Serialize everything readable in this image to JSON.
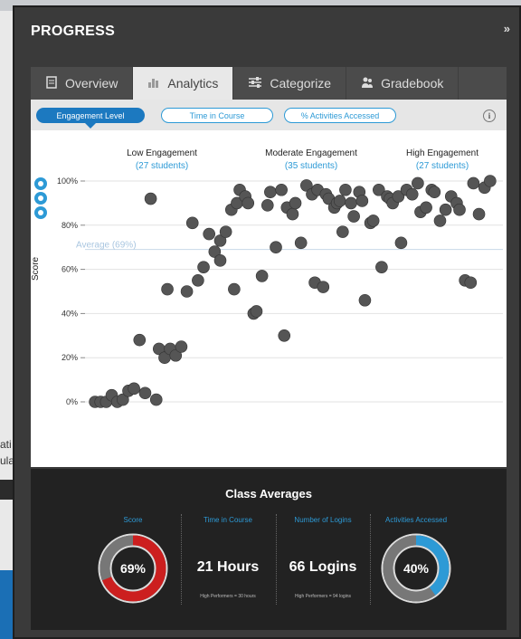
{
  "background": {
    "left_snippet": [
      "ati",
      "ula"
    ]
  },
  "panel": {
    "title": "PROGRESS",
    "collapse_icon": "double-chevron-right-icon"
  },
  "tabs": [
    {
      "label": "Overview",
      "icon": "book-icon",
      "active": false
    },
    {
      "label": "Analytics",
      "icon": "bar-chart-icon",
      "active": true
    },
    {
      "label": "Categorize",
      "icon": "sliders-icon",
      "active": false
    },
    {
      "label": "Gradebook",
      "icon": "people-icon",
      "active": false
    }
  ],
  "subtabs": [
    {
      "label": "Engagement Level",
      "active": true
    },
    {
      "label": "Time in Course",
      "active": false
    },
    {
      "label": "% Activities Accessed",
      "active": false
    }
  ],
  "groups": [
    {
      "label": "Low Engagement",
      "count": "(27 students)"
    },
    {
      "label": "Moderate Engagement",
      "count": "(35 students)"
    },
    {
      "label": "High Engagement",
      "count": "(27 students)"
    }
  ],
  "chart_data": {
    "type": "scatter",
    "ylabel": "Score",
    "ylim": [
      0,
      100
    ],
    "y_ticks": [
      "0%",
      "20%",
      "40%",
      "60%",
      "80%",
      "100%"
    ],
    "average_label": "Average (69%)",
    "average_value": 69,
    "x_range": [
      0,
      100
    ],
    "points": [
      [
        1,
        0
      ],
      [
        3,
        0
      ],
      [
        5,
        0
      ],
      [
        7,
        3
      ],
      [
        9,
        0
      ],
      [
        11,
        1
      ],
      [
        13,
        5
      ],
      [
        15,
        6
      ],
      [
        17,
        28
      ],
      [
        19,
        4
      ],
      [
        21,
        92
      ],
      [
        23,
        1
      ],
      [
        24,
        24
      ],
      [
        26,
        20
      ],
      [
        28,
        24
      ],
      [
        30,
        21
      ],
      [
        32,
        25
      ],
      [
        27,
        51
      ],
      [
        34,
        50
      ],
      [
        36,
        81
      ],
      [
        38,
        55
      ],
      [
        40,
        61
      ],
      [
        42,
        76
      ],
      [
        44,
        68
      ],
      [
        46,
        73
      ],
      [
        48,
        77
      ],
      [
        46,
        64
      ],
      [
        50,
        87
      ],
      [
        51,
        51
      ],
      [
        52,
        90
      ],
      [
        53,
        96
      ],
      [
        55,
        93
      ],
      [
        56,
        90
      ],
      [
        58,
        40
      ],
      [
        59,
        41
      ],
      [
        61,
        57
      ],
      [
        63,
        89
      ],
      [
        64,
        95
      ],
      [
        66,
        70
      ],
      [
        68,
        96
      ],
      [
        69,
        30
      ],
      [
        70,
        88
      ],
      [
        72,
        85
      ],
      [
        73,
        90
      ],
      [
        75,
        72
      ],
      [
        77,
        98
      ],
      [
        79,
        94
      ],
      [
        80,
        54
      ],
      [
        81,
        96
      ],
      [
        83,
        52
      ],
      [
        84,
        94
      ],
      [
        85,
        92
      ],
      [
        87,
        88
      ],
      [
        88,
        90
      ],
      [
        89,
        91
      ],
      [
        90,
        77
      ],
      [
        91,
        96
      ],
      [
        93,
        90
      ],
      [
        94,
        84
      ],
      [
        96,
        95
      ],
      [
        97,
        91
      ],
      [
        98,
        46
      ],
      [
        100,
        81
      ],
      [
        101,
        82
      ],
      [
        103,
        96
      ],
      [
        104,
        61
      ],
      [
        106,
        93
      ],
      [
        107,
        92
      ],
      [
        108,
        90
      ],
      [
        110,
        93
      ],
      [
        111,
        72
      ],
      [
        113,
        96
      ],
      [
        115,
        94
      ],
      [
        117,
        99
      ],
      [
        118,
        86
      ],
      [
        120,
        88
      ],
      [
        122,
        96
      ],
      [
        123,
        95
      ],
      [
        125,
        82
      ],
      [
        127,
        87
      ],
      [
        129,
        93
      ],
      [
        131,
        90
      ],
      [
        132,
        87
      ],
      [
        134,
        55
      ],
      [
        136,
        54
      ],
      [
        137,
        99
      ],
      [
        139,
        85
      ],
      [
        141,
        97
      ],
      [
        143,
        100
      ]
    ]
  },
  "class_averages": {
    "title": "Class Averages",
    "stats": [
      {
        "head": "Score",
        "value": "69%",
        "percent": 69,
        "color": "#cc1f1f"
      },
      {
        "head": "Time in Course",
        "value": "21 Hours",
        "sub": "High Performers = 30 hours"
      },
      {
        "head": "Number of Logins",
        "value": "66 Logins",
        "sub": "High Performers = 94 logins"
      },
      {
        "head": "Activities Accessed",
        "value": "40%",
        "percent": 40,
        "color": "#2d9ad6"
      }
    ]
  },
  "colors": {
    "accent": "#2d9ad6",
    "point": "#555555",
    "score_ring": "#cc1f1f",
    "ring_rest": "#777777"
  }
}
